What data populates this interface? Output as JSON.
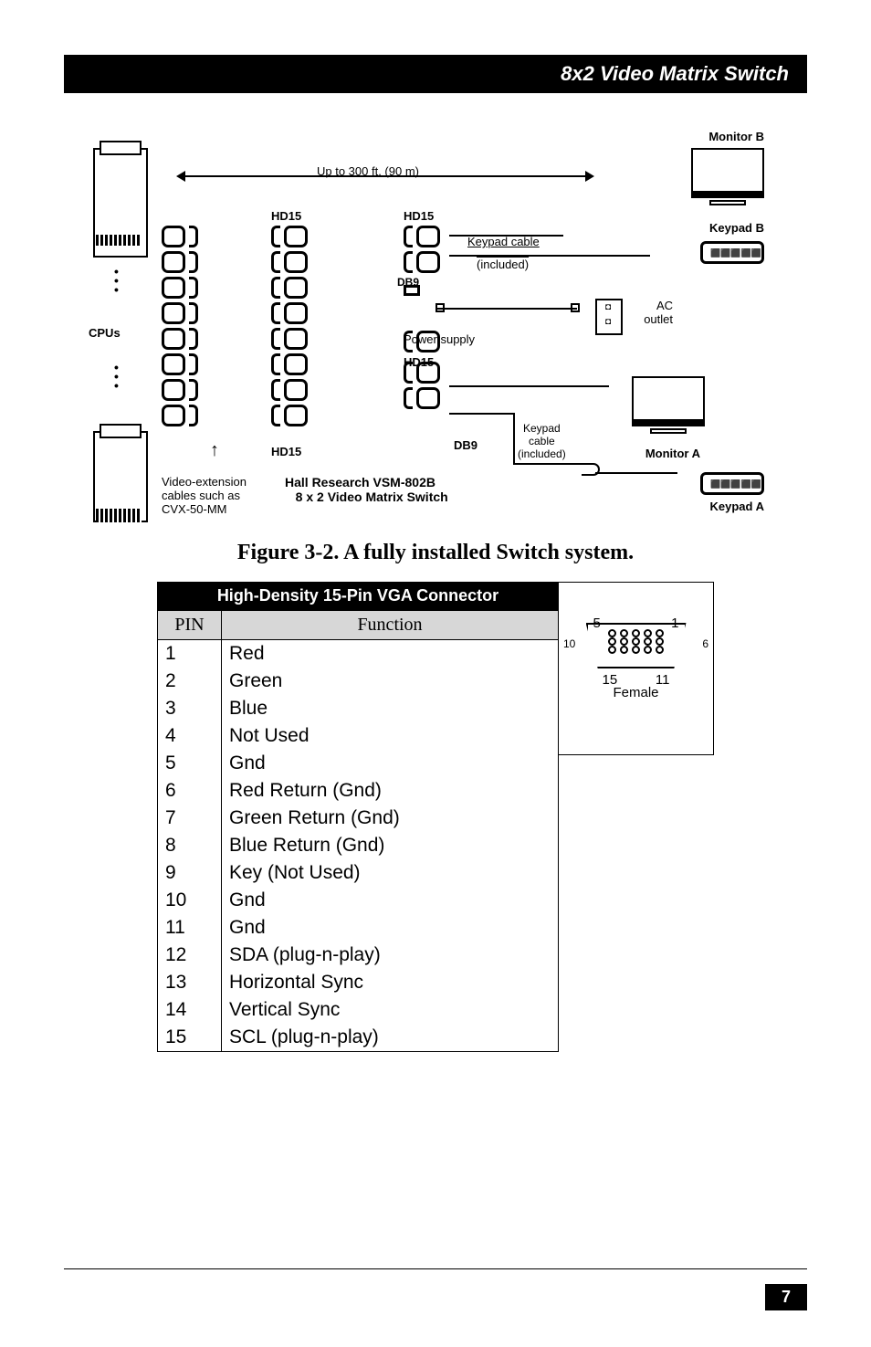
{
  "header": {
    "title": "8x2 Video Matrix Switch"
  },
  "diagram": {
    "monitor_b": "Monitor B",
    "monitor_a": "Monitor A",
    "keypad_b": "Keypad B",
    "keypad_a": "Keypad A",
    "distance": "Up to 300 ft. (90 m)",
    "hd15": "HD15",
    "db9": "DB9",
    "keypad_cable": "Keypad cable",
    "included": "(included)",
    "ac_outlet_1": "AC",
    "ac_outlet_2": "outlet",
    "power_supply": "Power supply",
    "keypad_cable2_1": "Keypad",
    "keypad_cable2_2": "cable",
    "keypad_cable2_3": "(included)",
    "cpus": "CPUs",
    "ext_1": "Video-extension",
    "ext_2": "cables such as",
    "ext_3": "CVX-50-MM",
    "device_1": "Hall Research VSM-802B",
    "device_2": "8 x 2 Video Matrix Switch"
  },
  "figure_caption": "Figure 3-2. A fully installed Switch system.",
  "table": {
    "header": "High-Density 15-Pin VGA Connector",
    "col_pin": "PIN",
    "col_func": "Function",
    "rows": [
      {
        "pin": "1",
        "func": "Red"
      },
      {
        "pin": "2",
        "func": "Green"
      },
      {
        "pin": "3",
        "func": "Blue"
      },
      {
        "pin": "4",
        "func": "Not Used"
      },
      {
        "pin": "5",
        "func": "Gnd"
      },
      {
        "pin": "6",
        "func": "Red Return (Gnd)"
      },
      {
        "pin": "7",
        "func": "Green Return (Gnd)"
      },
      {
        "pin": "8",
        "func": "Blue Return (Gnd)"
      },
      {
        "pin": "9",
        "func": "Key (Not Used)"
      },
      {
        "pin": "10",
        "func": "Gnd"
      },
      {
        "pin": "11",
        "func": "Gnd"
      },
      {
        "pin": "12",
        "func": "SDA (plug-n-play)"
      },
      {
        "pin": "13",
        "func": "Horizontal Sync"
      },
      {
        "pin": "14",
        "func": "Vertical Sync"
      },
      {
        "pin": "15",
        "func": "SCL (plug-n-play)"
      }
    ]
  },
  "connector": {
    "n5": "5",
    "n1": "1",
    "n10": "10",
    "n6": "6",
    "n15": "15",
    "n11": "11",
    "gender": "Female"
  },
  "page_number": "7"
}
